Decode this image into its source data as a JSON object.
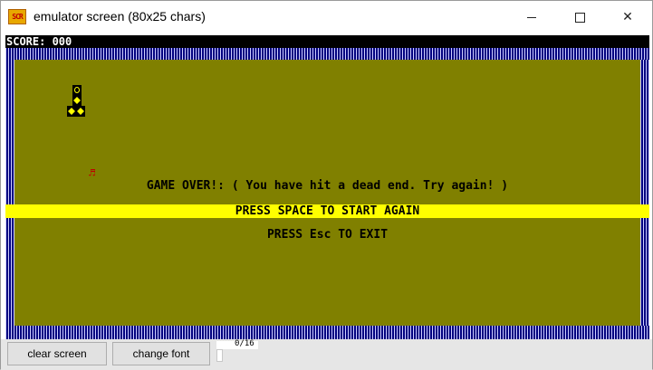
{
  "window": {
    "icon_text": "SCR",
    "title": "emulator screen (80x25 chars)",
    "minimize": "minimize",
    "maximize": "maximize",
    "close": "✕"
  },
  "game": {
    "score": "SCORE: 000",
    "food_glyph": "♬",
    "gameover_text": "GAME OVER!: ( You have hit a dead end. Try again! )",
    "press_space_text": "PRESS SPACE TO START AGAIN",
    "press_esc_text": "PRESS Esc TO EXIT",
    "colors": {
      "field": "#808000",
      "border": "#000080",
      "highlight": "#ffff00",
      "snake": "#ffff00",
      "food": "#c00000"
    }
  },
  "toolbar": {
    "clear_label": "clear screen",
    "font_label": "change font",
    "counter": "0/16"
  }
}
